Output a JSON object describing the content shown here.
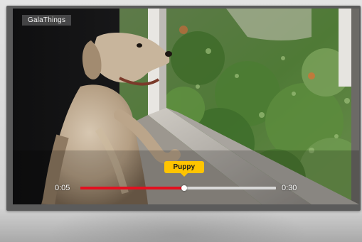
{
  "player": {
    "watermark": "GalaThings",
    "current_time": "0:05",
    "duration": "0:30",
    "preview_label": "Puppy",
    "progress_fraction": 0.53
  },
  "colors": {
    "progress_fill": "#e3101f",
    "progress_track": "#d8d8d8",
    "tooltip_bg": "#ffc400"
  },
  "icons": {
    "scrubber": "circle-handle-icon"
  }
}
